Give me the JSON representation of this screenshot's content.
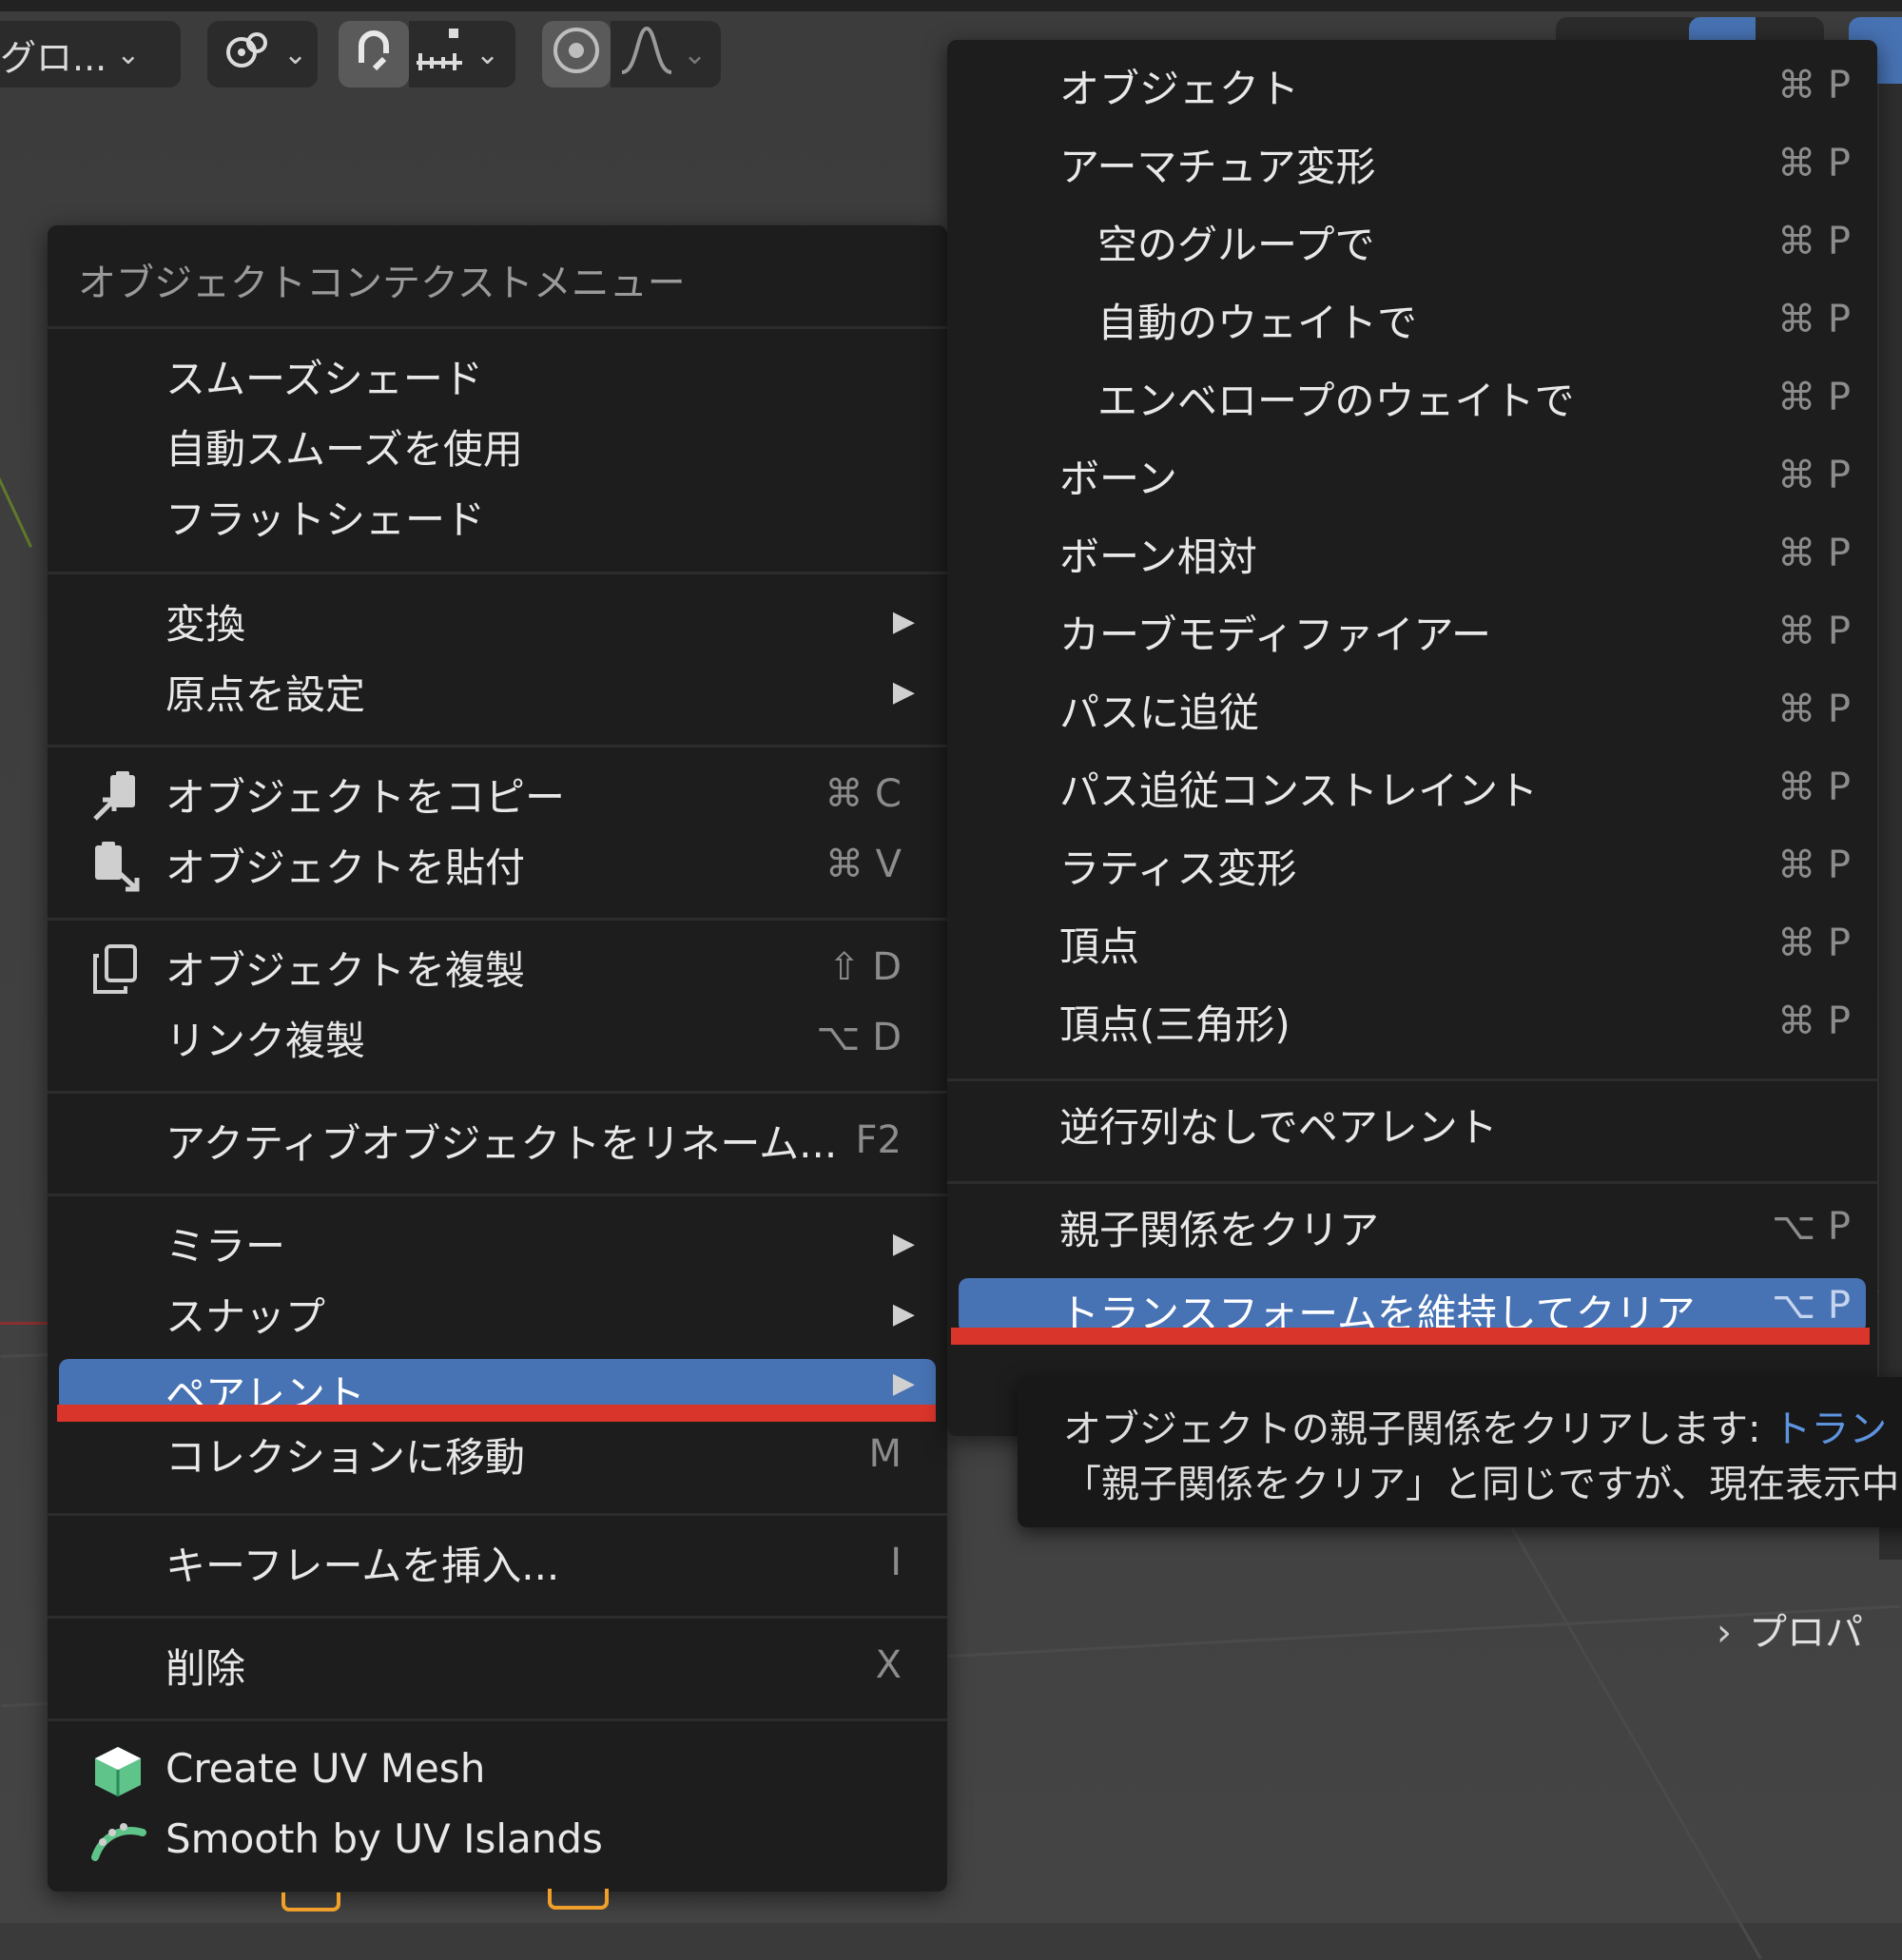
{
  "toolbar": {
    "transform_orientation": "グロ...",
    "pivot_icon": "pivot-icon",
    "snap_icon": "magnet-icon",
    "snap_target_icon": "snap-increment-icon",
    "proportional_icon": "proportional-edit-icon",
    "falloff_icon": "falloff-curve-icon"
  },
  "main_menu": {
    "title": "オブジェクトコンテクストメニュー",
    "items": [
      {
        "label": "スムーズシェード"
      },
      {
        "label": "自動スムーズを使用"
      },
      {
        "label": "フラットシェード"
      },
      {
        "label": "変換",
        "submenu": true
      },
      {
        "label": "原点を設定",
        "submenu": true
      },
      {
        "label": "オブジェクトをコピー",
        "shortcut": "⌘ C",
        "icon": "copy-icon"
      },
      {
        "label": "オブジェクトを貼付",
        "shortcut": "⌘ V",
        "icon": "paste-icon"
      },
      {
        "label": "オブジェクトを複製",
        "shortcut": "⇧ D",
        "icon": "duplicate-icon"
      },
      {
        "label": "リンク複製",
        "shortcut": "⌥ D"
      },
      {
        "label": "アクティブオブジェクトをリネーム...",
        "shortcut": "F2"
      },
      {
        "label": "ミラー",
        "submenu": true
      },
      {
        "label": "スナップ",
        "submenu": true
      },
      {
        "label": "ペアレント",
        "submenu": true,
        "highlighted": true
      },
      {
        "label": "コレクションに移動",
        "shortcut": "M"
      },
      {
        "label": "キーフレームを挿入...",
        "shortcut": "I"
      },
      {
        "label": "削除",
        "shortcut": "X"
      },
      {
        "label": "Create UV Mesh",
        "icon": "uv-mesh-icon"
      },
      {
        "label": "Smooth by UV Islands",
        "icon": "uv-smooth-icon"
      }
    ]
  },
  "sub_menu": {
    "items": [
      {
        "label": "オブジェクト",
        "shortcut": "⌘ P"
      },
      {
        "label": "アーマチュア変形",
        "shortcut": "⌘ P"
      },
      {
        "label": "空のグループで",
        "shortcut": "⌘ P"
      },
      {
        "label": "自動のウェイトで",
        "shortcut": "⌘ P"
      },
      {
        "label": "エンベロープのウェイトで",
        "shortcut": "⌘ P"
      },
      {
        "label": "ボーン",
        "shortcut": "⌘ P"
      },
      {
        "label": "ボーン相対",
        "shortcut": "⌘ P"
      },
      {
        "label": "カーブモディファイアー",
        "shortcut": "⌘ P"
      },
      {
        "label": "パスに追従",
        "shortcut": "⌘ P"
      },
      {
        "label": "パス追従コンストレイント",
        "shortcut": "⌘ P"
      },
      {
        "label": "ラティス変形",
        "shortcut": "⌘ P"
      },
      {
        "label": "頂点",
        "shortcut": "⌘ P"
      },
      {
        "label": "頂点(三角形)",
        "shortcut": "⌘ P"
      },
      {
        "label": "逆行列なしでペアレント"
      },
      {
        "label": "親子関係をクリア",
        "shortcut": "⌥ P"
      },
      {
        "label": "トランスフォームを維持してクリア",
        "shortcut": "⌥ P",
        "highlighted": true
      }
    ]
  },
  "tooltip": {
    "line1": "オブジェクトの親子関係をクリアします: ",
    "line1_highlight": "トラン",
    "line2": "「親子関係をクリア」と同じですが、現在表示中"
  },
  "side_panel": {
    "properties_label": "プロパ"
  },
  "colors": {
    "highlight": "#4772b3",
    "annotation_red": "#d9352b",
    "menu_bg": "#1d1d1d"
  }
}
